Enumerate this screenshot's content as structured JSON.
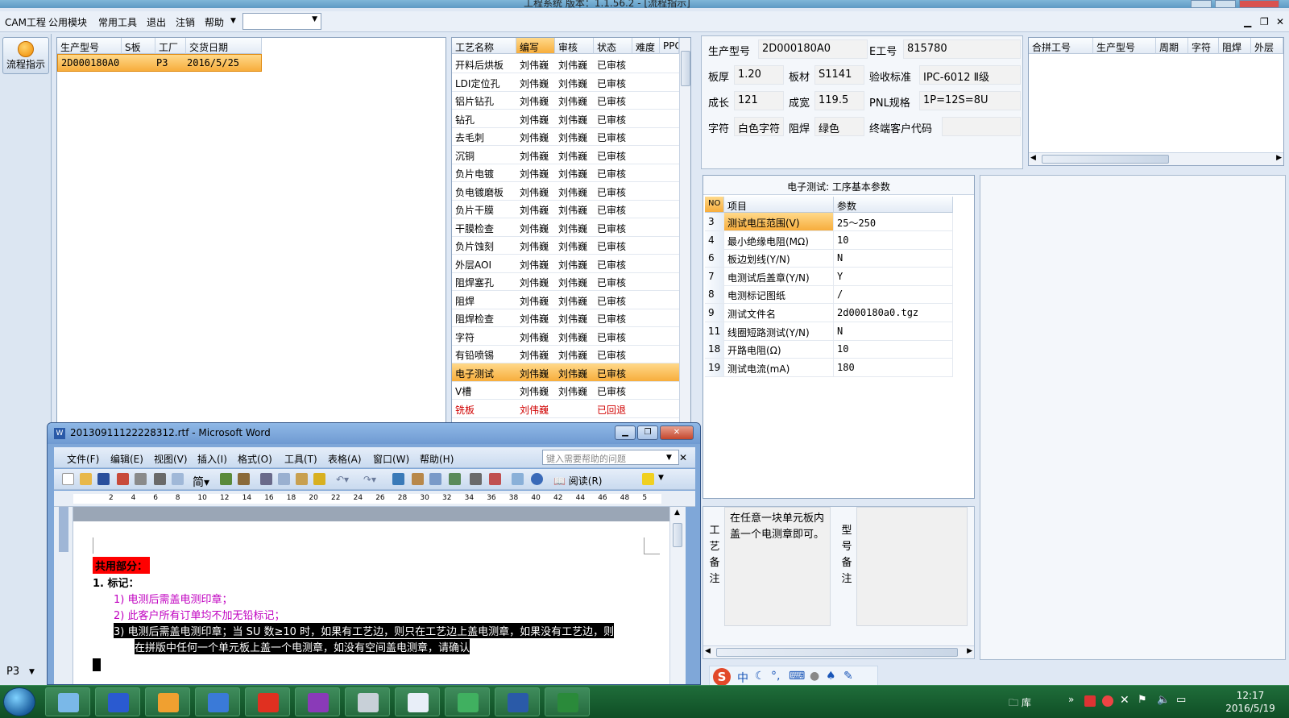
{
  "app": {
    "title": "工程系统  版本：1.1.56.2 - [流程指示]"
  },
  "menu": {
    "items": [
      "CAM工程",
      "公用模块",
      "常用工具",
      "退出",
      "注销",
      "帮助"
    ],
    "combo_value": ""
  },
  "sidebar": {
    "flow_button": "流程指示",
    "bottom_combo": "P3"
  },
  "orders": {
    "columns": [
      "生产型号",
      "S板",
      "工厂",
      "交货日期"
    ],
    "rows": [
      {
        "model": "2D000180A0",
        "s": "",
        "factory": "P3",
        "date": "2016/5/25"
      }
    ]
  },
  "process": {
    "columns": [
      "工艺名称",
      "编写",
      "审核",
      "状态",
      "难度",
      "PPG"
    ],
    "rows": [
      {
        "name": "开料后烘板",
        "writer": "刘伟巍",
        "reviewer": "刘伟巍",
        "status": "已审核"
      },
      {
        "name": "LDI定位孔",
        "writer": "刘伟巍",
        "reviewer": "刘伟巍",
        "status": "已审核"
      },
      {
        "name": "铝片钻孔",
        "writer": "刘伟巍",
        "reviewer": "刘伟巍",
        "status": "已审核"
      },
      {
        "name": "钻孔",
        "writer": "刘伟巍",
        "reviewer": "刘伟巍",
        "status": "已审核"
      },
      {
        "name": "去毛刺",
        "writer": "刘伟巍",
        "reviewer": "刘伟巍",
        "status": "已审核"
      },
      {
        "name": "沉铜",
        "writer": "刘伟巍",
        "reviewer": "刘伟巍",
        "status": "已审核"
      },
      {
        "name": "负片电镀",
        "writer": "刘伟巍",
        "reviewer": "刘伟巍",
        "status": "已审核"
      },
      {
        "name": "负电镀磨板",
        "writer": "刘伟巍",
        "reviewer": "刘伟巍",
        "status": "已审核"
      },
      {
        "name": "负片干膜",
        "writer": "刘伟巍",
        "reviewer": "刘伟巍",
        "status": "已审核"
      },
      {
        "name": "干膜检查",
        "writer": "刘伟巍",
        "reviewer": "刘伟巍",
        "status": "已审核"
      },
      {
        "name": "负片蚀刻",
        "writer": "刘伟巍",
        "reviewer": "刘伟巍",
        "status": "已审核"
      },
      {
        "name": "外层AOI",
        "writer": "刘伟巍",
        "reviewer": "刘伟巍",
        "status": "已审核"
      },
      {
        "name": "阻焊塞孔",
        "writer": "刘伟巍",
        "reviewer": "刘伟巍",
        "status": "已审核"
      },
      {
        "name": "阻焊",
        "writer": "刘伟巍",
        "reviewer": "刘伟巍",
        "status": "已审核"
      },
      {
        "name": "阻焊检查",
        "writer": "刘伟巍",
        "reviewer": "刘伟巍",
        "status": "已审核"
      },
      {
        "name": "字符",
        "writer": "刘伟巍",
        "reviewer": "刘伟巍",
        "status": "已审核"
      },
      {
        "name": "有铅喷锡",
        "writer": "刘伟巍",
        "reviewer": "刘伟巍",
        "status": "已审核"
      },
      {
        "name": "电子测试",
        "writer": "刘伟巍",
        "reviewer": "刘伟巍",
        "status": "已审核",
        "selected": true
      },
      {
        "name": "V槽",
        "writer": "刘伟巍",
        "reviewer": "刘伟巍",
        "status": "已审核"
      },
      {
        "name": "铣板",
        "writer": "刘伟巍",
        "reviewer": "",
        "status": "已回退",
        "rejected": true
      }
    ]
  },
  "info": {
    "model_label": "生产型号",
    "model_value": "2D000180A0",
    "e_label": "E工号",
    "e_value": "815780",
    "thick_label": "板厚",
    "thick_value": "1.20",
    "material_label": "板材",
    "material_value": "S1141",
    "standard_label": "验收标准",
    "standard_value": "IPC-6012 Ⅱ级",
    "length_label": "成长",
    "length_value": "121",
    "width_label": "成宽",
    "width_value": "119.5",
    "pnl_label": "PNL规格",
    "pnl_value": "1P=12S=8U",
    "char_label": "字符",
    "char_value": "白色字符",
    "mask_label": "阻焊",
    "mask_value": "绿色",
    "customer_label": "终端客户代码",
    "customer_value": ""
  },
  "combo_grid": {
    "columns": [
      "合拼工号",
      "生产型号",
      "周期",
      "字符",
      "阻焊",
      "外层"
    ]
  },
  "params": {
    "title": "电子测试: 工序基本参数",
    "columns": [
      "NO",
      "项目",
      "参数"
    ],
    "rows": [
      {
        "no": "3",
        "item": "测试电压范围(V)",
        "value": "25～250"
      },
      {
        "no": "4",
        "item": "最小绝缘电阻(MΩ)",
        "value": "10"
      },
      {
        "no": "6",
        "item": "板边划线(Y/N)",
        "value": "N"
      },
      {
        "no": "7",
        "item": "电测试后盖章(Y/N)",
        "value": "Y"
      },
      {
        "no": "8",
        "item": "电测标记图纸",
        "value": "/"
      },
      {
        "no": "9",
        "item": "测试文件名",
        "value": "2d000180a0.tgz"
      },
      {
        "no": "11",
        "item": "线圈短路测试(Y/N)",
        "value": "N"
      },
      {
        "no": "18",
        "item": "开路电阻(Ω)",
        "value": "10"
      },
      {
        "no": "19",
        "item": "测试电流(mA)",
        "value": "180"
      }
    ]
  },
  "remarks": {
    "process_label": "工艺备注",
    "process_text": "在任意一块单元板内盖一个电测章即可。",
    "model_label": "型号备注",
    "model_text": ""
  },
  "word": {
    "title": "20130911122228312.rtf - Microsoft Word",
    "menu": [
      "文件(F)",
      "编辑(E)",
      "视图(V)",
      "插入(I)",
      "格式(O)",
      "工具(T)",
      "表格(A)",
      "窗口(W)",
      "帮助(H)"
    ],
    "help_placeholder": "键入需要帮助的问题",
    "read_button": "阅读(R)",
    "ruler": [
      "2",
      "4",
      "6",
      "8",
      "10",
      "12",
      "14",
      "16",
      "18",
      "20",
      "22",
      "24",
      "26",
      "28",
      "30",
      "32",
      "34",
      "36",
      "38",
      "40",
      "42",
      "44",
      "46",
      "48",
      "5"
    ],
    "doc": {
      "heading": "共用部分：",
      "item1": "1.   标记：",
      "line1": "1)   电测后需盖电测印章；",
      "line2": "2)   此客户所有订单均不加无铅标记；",
      "line3a": "3)   电测后需盖电测印章；当 SU 数≥10 时，如果有工艺边，则只在工艺边上盖电测章，如果没有工艺边，则",
      "line3b": "在拼版中任何一个单元板上盖一个电测章，如没有空间盖电测章，请确认"
    }
  },
  "taskbar": {
    "library": "库",
    "time": "12:17",
    "date": "2016/5/19"
  },
  "colors": {
    "selection": "#f7ad3c",
    "rejected": "#d00000",
    "highlight_red": "#ff0000",
    "magenta_text": "#c000c0",
    "taskbar": "#0f4e25"
  }
}
